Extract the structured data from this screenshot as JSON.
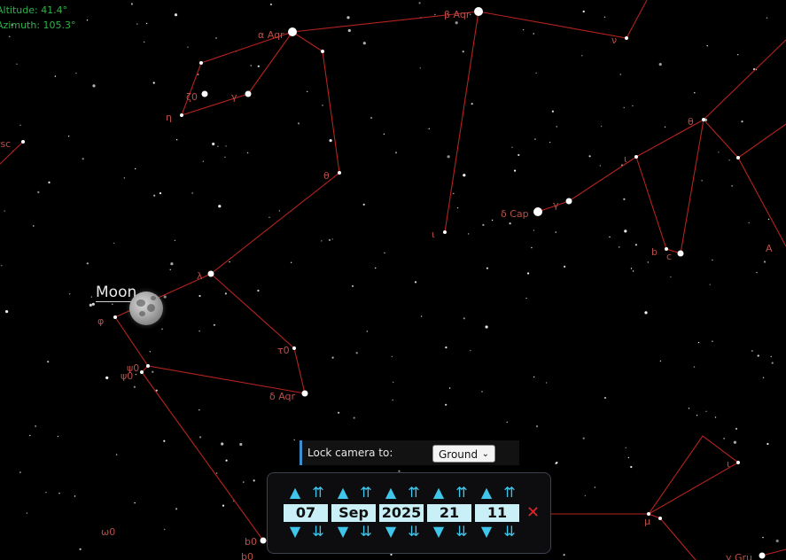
{
  "readouts": {
    "altitude": "Altitude: 41.4°",
    "azimuth": "Azimuth: 105.3°"
  },
  "constellation_labels": {
    "alpha_aqr": "α Aqr",
    "beta_aqr": "β Aqr",
    "nu": "ν",
    "zeta0": "ζ0",
    "gamma": "γ",
    "eta": "η",
    "psc": "Psc",
    "theta_left": "θ",
    "iota_aqr": "ι",
    "delta_cap": "δ Cap",
    "gamma_cap": "γ",
    "theta_right": "θ",
    "iota_right": "ι",
    "b": "b",
    "c": "c",
    "A": "A",
    "lambda": "λ",
    "phi": "φ",
    "tau0": "τ0",
    "psi0_upper": "ψ0",
    "psi0_lower": "ψ0",
    "delta_aqr": "δ Aqr",
    "omega0": "ω0",
    "b0": "b0",
    "b0_lower": "b0",
    "mu": "μ",
    "iota_low": "ι",
    "gru": "γ Gru"
  },
  "moon": {
    "label": "Moon"
  },
  "lock_camera": {
    "label": "Lock camera to:",
    "selected": "Ground"
  },
  "time_control": {
    "fields": [
      {
        "name": "day",
        "value": "07"
      },
      {
        "name": "month",
        "value": "Sep"
      },
      {
        "name": "year",
        "value": "2025"
      },
      {
        "name": "hour",
        "value": "21"
      },
      {
        "name": "minute",
        "value": "11"
      }
    ],
    "up_step": "▲",
    "up_fast": "⇈",
    "down_step": "▼",
    "down_fast": "⇊",
    "close": "✕"
  },
  "colors": {
    "sky": "#000000",
    "lines": "#b4231e",
    "labels": "#b9504a",
    "accent": "#3fc6ea"
  }
}
